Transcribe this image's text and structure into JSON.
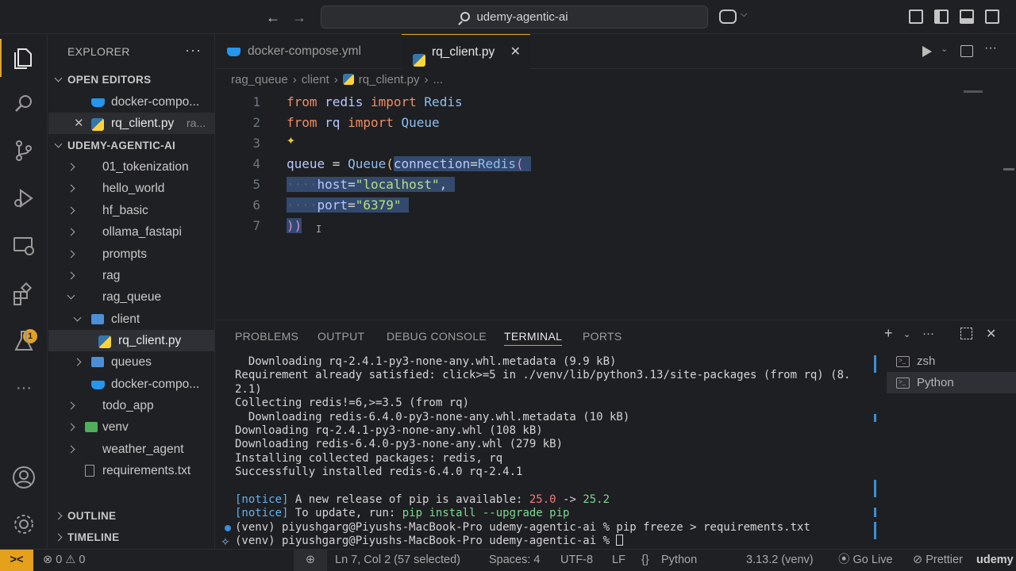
{
  "titlebar": {
    "search_text": "udemy-agentic-ai",
    "back_icon": "arrow-left-icon",
    "forward_icon": "arrow-right-icon"
  },
  "activity": {
    "extensions_badge": "1"
  },
  "sidebar": {
    "title": "EXPLORER",
    "more": "···",
    "open_editors_label": "OPEN EDITORS",
    "open_editors": [
      {
        "label": "docker-compo...",
        "icon": "docker-icon"
      },
      {
        "label": "rq_client.py",
        "hint": "ra...",
        "icon": "python-icon"
      }
    ],
    "workspace_label": "UDEMY-AGENTIC-AI",
    "tree": [
      {
        "label": "01_tokenization"
      },
      {
        "label": "hello_world"
      },
      {
        "label": "hf_basic"
      },
      {
        "label": "ollama_fastapi"
      },
      {
        "label": "prompts"
      },
      {
        "label": "rag"
      },
      {
        "label": "rag_queue"
      },
      {
        "label": "client"
      },
      {
        "label": "rq_client.py"
      },
      {
        "label": "queues"
      },
      {
        "label": "docker-compo..."
      },
      {
        "label": "todo_app"
      },
      {
        "label": "venv"
      },
      {
        "label": "weather_agent"
      },
      {
        "label": "requirements.txt"
      }
    ],
    "outline_label": "OUTLINE",
    "timeline_label": "TIMELINE"
  },
  "tabs": [
    {
      "label": "docker-compose.yml"
    },
    {
      "label": "rq_client.py",
      "active": true
    }
  ],
  "breadcrumb": {
    "parts": [
      "rag_queue",
      "client",
      "rq_client.py",
      "..."
    ],
    "separator": "›"
  },
  "editor": {
    "line_numbers": [
      "1",
      "2",
      "3",
      "4",
      "5",
      "6",
      "7"
    ],
    "lines": {
      "l1": {
        "kw1": "from",
        "mod": "redis",
        "kw2": "import",
        "name": "Redis"
      },
      "l2": {
        "kw1": "from",
        "mod": "rq",
        "kw2": "import",
        "name": "Queue"
      },
      "l4": {
        "var": "queue",
        "eq": " = ",
        "cls": "Queue",
        "paren": "(",
        "param": "connection",
        "eq2": "=",
        "cls2": "Redis",
        "paren2": "("
      },
      "l5": {
        "indent": "····",
        "param": "host",
        "eq": "=",
        "str": "\"localhost\"",
        "comma": ","
      },
      "l6": {
        "indent": "····",
        "param": "port",
        "eq": "=",
        "str": "\"6379\""
      },
      "l7": {
        "close": "))"
      }
    }
  },
  "panel": {
    "tabs": [
      "PROBLEMS",
      "OUTPUT",
      "DEBUG CONSOLE",
      "TERMINAL",
      "PORTS"
    ],
    "active_tab": "TERMINAL",
    "terminal_lines": [
      "  Downloading rq-2.4.1-py3-none-any.whl.metadata (9.9 kB)",
      "Requirement already satisfied: click>=5 in ./venv/lib/python3.13/site-packages (from rq) (8.",
      "2.1)",
      "Collecting redis!=6,>=3.5 (from rq)",
      "  Downloading redis-6.4.0-py3-none-any.whl.metadata (10 kB)",
      "Downloading rq-2.4.1-py3-none-any.whl (108 kB)",
      "Downloading redis-6.4.0-py3-none-any.whl (279 kB)",
      "Installing collected packages: redis, rq",
      "Successfully installed redis-6.4.0 rq-2.4.1",
      ""
    ],
    "notice1": {
      "tag": "[notice]",
      "text": " A new release of pip is available: ",
      "old": "25.0",
      "arrow": " -> ",
      "new": "25.2"
    },
    "notice2": {
      "tag": "[notice]",
      "text": " To update, run: ",
      "cmd": "pip install --upgrade pip"
    },
    "prompt1": "(venv) piyushgarg@Piyushs-MacBook-Pro udemy-agentic-ai % pip freeze > requirements.txt",
    "prompt2": "(venv) piyushgarg@Piyushs-MacBook-Pro udemy-agentic-ai % ",
    "terminals": [
      "zsh",
      "Python"
    ]
  },
  "statusbar": {
    "remote": "><",
    "errors": "0",
    "warnings": "0",
    "position": "Ln 7, Col 2 (57 selected)",
    "spaces": "Spaces: 4",
    "encoding": "UTF-8",
    "eol": "LF",
    "braces": "{}",
    "language": "Python",
    "interpreter": "3.13.2 (venv)",
    "golive": "Go Live",
    "prettier": "Prettier",
    "watermark": "udemy"
  }
}
